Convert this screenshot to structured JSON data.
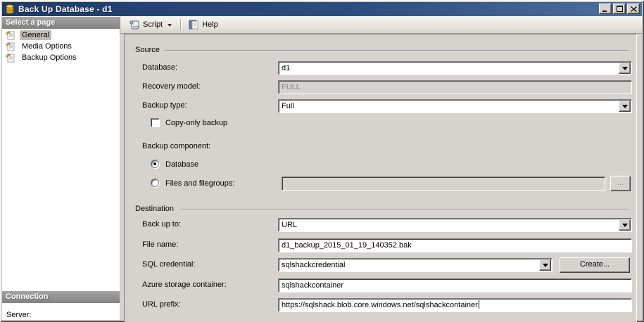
{
  "window": {
    "title": "Back Up Database - d1"
  },
  "icons": {
    "titlebar_app_icon": "database-cylinder",
    "titlebar_buttons": [
      "minimize",
      "maximize",
      "close"
    ],
    "toolbar": [
      "script-scroll-icon",
      "dropdown-arrow-icon",
      "help-book-icon"
    ],
    "sidebar_item_icon": "page-icon"
  },
  "toolbar": {
    "script_label": "Script",
    "help_label": "Help"
  },
  "sidebar": {
    "select_header": "Select a page",
    "items": [
      {
        "label": "General",
        "selected": true
      },
      {
        "label": "Media Options",
        "selected": false
      },
      {
        "label": "Backup Options",
        "selected": false
      }
    ],
    "connection_header": "Connection",
    "server_label": "Server:"
  },
  "source": {
    "group_label": "Source",
    "database_label": "Database:",
    "database_value": "d1",
    "recovery_model_label": "Recovery model:",
    "recovery_model_value": "FULL",
    "recovery_model_disabled": true,
    "backup_type_label": "Backup type:",
    "backup_type_value": "Full",
    "copy_only_label": "Copy-only backup",
    "copy_only_checked": false,
    "backup_component_label": "Backup component:",
    "database_radio_label": "Database",
    "database_radio_checked": true,
    "files_radio_label": "Files and filegroups:",
    "files_radio_checked": false,
    "files_value": "",
    "browse_button_label": "...",
    "browse_button_disabled": true
  },
  "destination": {
    "group_label": "Destination",
    "backup_to_label": "Back up to:",
    "backup_to_value": "URL",
    "file_name_label": "File name:",
    "file_name_value": "d1_backup_2015_01_19_140352.bak",
    "sql_credential_label": "SQL credential:",
    "sql_credential_value": "sqlshackcredential",
    "create_button_label": "Create...",
    "azure_container_label": "Azure storage container:",
    "azure_container_value": "sqlshackcontainer",
    "url_prefix_label": "URL prefix:",
    "url_prefix_value": "https://sqlshack.blob.core.windows.net/sqlshackcontainer"
  },
  "colors": {
    "titlebar_start": "#1e3a68",
    "titlebar_end": "#4f6f9f",
    "panel_bg": "#d6d3ce",
    "sidebar_header_bg": "#8f8f8f",
    "selected_item_bg": "#c1beb7",
    "disabled_text": "#848484"
  }
}
